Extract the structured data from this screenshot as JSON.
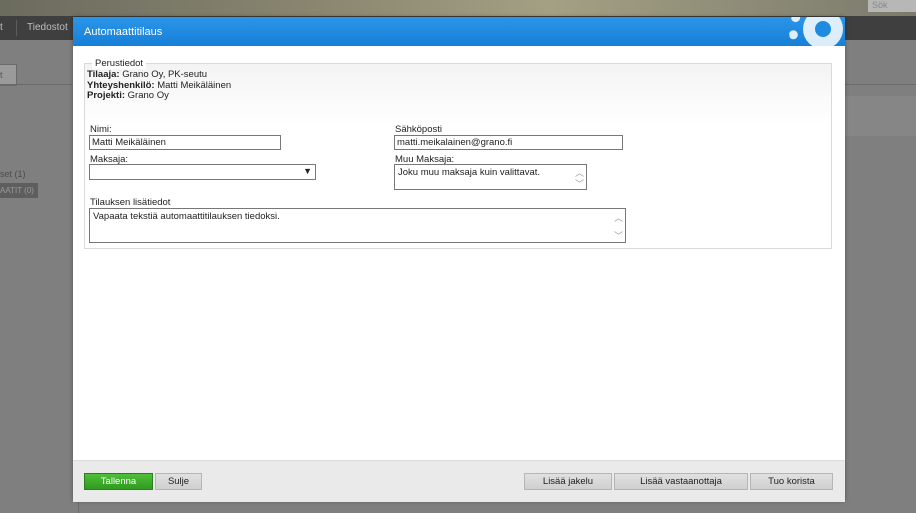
{
  "background": {
    "search_label": "Sök",
    "nav": [
      "t",
      "Tiedostot"
    ],
    "tab_label": "t",
    "left_list_item": "set (1)",
    "left_button": "AATIT (0)"
  },
  "dialog": {
    "title": "Automaattitilaus",
    "section_legend": "Perustiedot",
    "info": {
      "orderer_label": "Tilaaja:",
      "orderer_value": "Grano Oy, PK-seutu",
      "contact_label": "Yhteyshenkilö:",
      "contact_value": "Matti Meikäläinen",
      "project_label": "Projekti:",
      "project_value": "Grano Oy"
    },
    "form": {
      "name_label": "Nimi:",
      "name_value": "Matti Meikäläinen",
      "email_label": "Sähköposti",
      "email_value": "matti.meikalainen@grano.fi",
      "payer_label": "Maksaja:",
      "payer_value": "",
      "other_payer_label": "Muu Maksaja:",
      "other_payer_value": "Joku muu maksaja kuin valittavat.",
      "details_label": "Tilauksen lisätiedot",
      "details_value": "Vapaata tekstiä automaattitilauksen tiedoksi."
    },
    "buttons": {
      "save": "Tallenna",
      "close": "Sulje",
      "add_distribution": "Lisää jakelu",
      "add_recipient": "Lisää vastaanottaja",
      "import_cart": "Tuo korista"
    },
    "colors": {
      "titlebar": "#1a86dc",
      "save_button": "#3aa82a"
    }
  },
  "icons": [
    "gear-icon",
    "chevron-down-icon",
    "scroll-up-icon",
    "scroll-down-icon"
  ]
}
